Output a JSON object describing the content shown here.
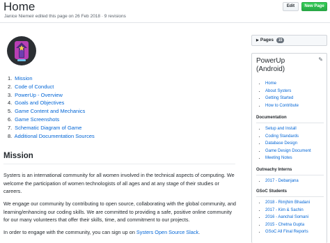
{
  "header": {
    "title": "Home",
    "meta": "Janice Niemeir edited this page on 26 Feb 2018 · 9 revisions",
    "edit_label": "Edit",
    "new_page_label": "New Page"
  },
  "toc": [
    {
      "num": "1.",
      "label": "Mission"
    },
    {
      "num": "2.",
      "label": "Code of Conduct"
    },
    {
      "num": "3.",
      "label": "PowerUp - Overview"
    },
    {
      "num": "4.",
      "label": "Goals and Objectives"
    },
    {
      "num": "5.",
      "label": "Game Content and Mechanics"
    },
    {
      "num": "6.",
      "label": "Game Screenshots"
    },
    {
      "num": "7.",
      "label": "Schematic Diagram of Game"
    },
    {
      "num": "8.",
      "label": "Additional Documentation Sources"
    }
  ],
  "mission": {
    "heading": "Mission",
    "p1": "Systers is an international community for all women involved in the technical aspects of computing. We welcome the participation of women technologists of all ages and at any stage of their studies or careers.",
    "p2": "We engage our community by contributing to open source, collaborating with the global community, and learning/enhancing our coding skills. We are committed to providing a safe, positive online community for our many volunteers that offer their skills, time, and commitment to our projects.",
    "p3_prefix": "In order to engage with the community, you can sign up on ",
    "p3_link": "Systers Open Source Slack",
    "p3_suffix": "."
  },
  "pages": {
    "label": "Pages",
    "count": "15"
  },
  "sidebar": {
    "title": "PowerUp (Android)",
    "main_links": [
      "Home",
      "About Systers",
      "Getting Started",
      "How to Contribute"
    ],
    "documentation_heading": "Documentation",
    "documentation_links": [
      "Setup and Install",
      "Coding Standards",
      "Database Design",
      "Game Design Document",
      "Meeting Notes"
    ],
    "outreachy_heading": "Outreachy Interns",
    "outreachy_links": [
      "2017 - Debanjana"
    ],
    "gsoc_heading": "GSoC Students",
    "gsoc_links": [
      "2018 - Rimjhim Bhadani",
      "2017 - Kim & Sachin",
      "2016 - Aanchal Somani",
      "2015 - Chetna Gupta",
      "GSoC All Final Reports"
    ]
  }
}
